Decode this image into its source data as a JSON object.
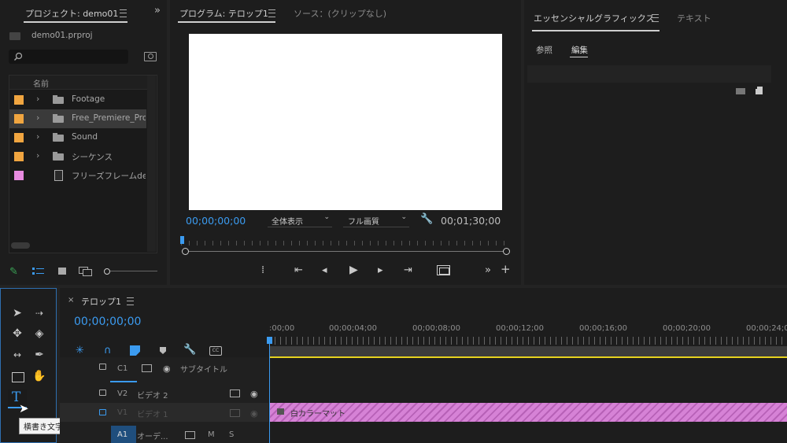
{
  "project_panel": {
    "tab_label": "プロジェクト: demo01",
    "file_name": "demo01.prproj",
    "search_placeholder": "",
    "column_name": "名前",
    "items": [
      {
        "label": "Footage",
        "color": "#f0a540",
        "kind": "folder"
      },
      {
        "label": "Free_Premiere_Pro",
        "color": "#f0a540",
        "kind": "folder"
      },
      {
        "label": "Sound",
        "color": "#f0a540",
        "kind": "folder"
      },
      {
        "label": "シーケンス",
        "color": "#f0a540",
        "kind": "folder"
      },
      {
        "label": "フリーズフレームde",
        "color": "#e88be0",
        "kind": "clip"
      }
    ]
  },
  "program_monitor": {
    "tab_label": "プログラム: テロップ1",
    "source_tab_label": "ソース：(クリップなし)",
    "timecode_current": "00;00;00;00",
    "timecode_duration": "00;01;30;00",
    "zoom_select": "全体表示",
    "quality_select": "フル画質"
  },
  "essential_graphics": {
    "tab_label": "エッセンシャルグラフィックス",
    "text_tab_label": "テキスト",
    "subtab_browse": "参照",
    "subtab_edit": "編集"
  },
  "timeline": {
    "sequence_tab_label": "テロップ1",
    "timecode": "00;00;00;00",
    "ruler_labels": [
      ":00;00",
      "00;00;04;00",
      "00;00;08;00",
      "00;00;12;00",
      "00;00;16;00",
      "00;00;20;00",
      "00;00;24;0"
    ],
    "tracks": [
      {
        "id": "C1",
        "name": "サブタイトル"
      },
      {
        "id": "V2",
        "name": "ビデオ 2"
      },
      {
        "id": "V1",
        "name": "ビデオ 1"
      },
      {
        "id": "A1",
        "name": "オーデ...",
        "m": "M",
        "s": "S"
      }
    ],
    "clip_label": "白カラーマット",
    "clip_color": "#d682d6"
  },
  "tools": {
    "tooltip": "横書き文字ツール (T)"
  }
}
